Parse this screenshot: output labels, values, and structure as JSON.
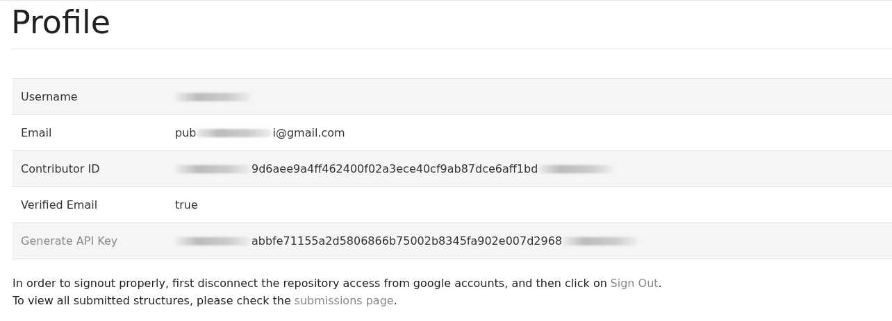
{
  "title": "Profile",
  "rows": [
    {
      "label": "Username",
      "muted": false,
      "value": [
        {
          "kind": "redacted"
        }
      ]
    },
    {
      "label": "Email",
      "muted": false,
      "value": [
        {
          "kind": "text",
          "text": "pub"
        },
        {
          "kind": "redacted"
        },
        {
          "kind": "text",
          "text": "i@gmail.com"
        }
      ]
    },
    {
      "label": "Contributor ID",
      "muted": false,
      "value": [
        {
          "kind": "redacted"
        },
        {
          "kind": "text",
          "text": "9d6aee9a4ff462400f02a3ece40cf9ab87dce6aff1bd"
        },
        {
          "kind": "redacted"
        }
      ]
    },
    {
      "label": "Verified Email",
      "muted": false,
      "value": [
        {
          "kind": "text",
          "text": "true"
        }
      ]
    },
    {
      "label": "Generate API Key",
      "muted": true,
      "value": [
        {
          "kind": "redacted"
        },
        {
          "kind": "text",
          "text": "abbfe71155a2d5806866b75002b8345fa902e007d2968"
        },
        {
          "kind": "redacted"
        }
      ]
    }
  ],
  "notes": [
    [
      {
        "kind": "text",
        "text": "In order to signout properly, first disconnect the repository access from google accounts, and then click on"
      },
      {
        "kind": "link",
        "text": "Sign Out"
      },
      {
        "kind": "text",
        "text": "."
      }
    ],
    [
      {
        "kind": "text",
        "text": "To view all submitted structures, please check the"
      },
      {
        "kind": "link",
        "text": "submissions page"
      },
      {
        "kind": "text",
        "text": "."
      }
    ]
  ]
}
